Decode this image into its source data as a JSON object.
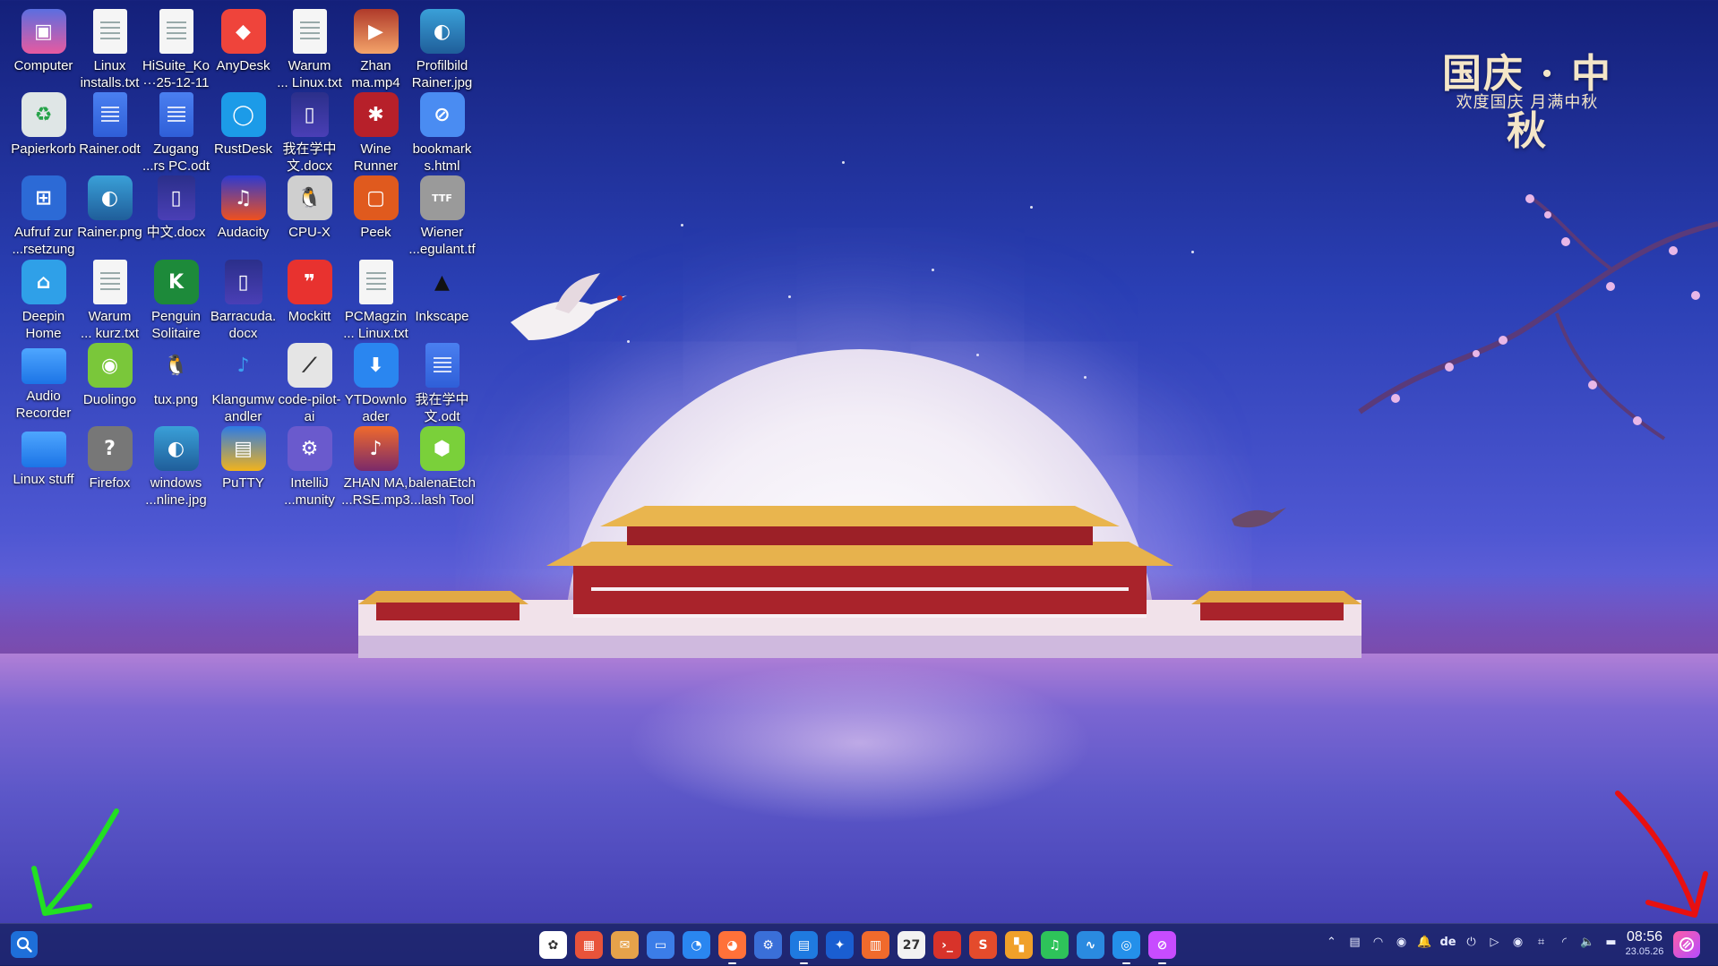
{
  "wallpaper": {
    "title": "国庆 · 中秋",
    "subtitle": "欢度国庆 月满中秋"
  },
  "desktop_icons": [
    {
      "label": "Computer",
      "icon": "computer-icon"
    },
    {
      "label": "Linux\ninstalls.txt",
      "icon": "text-file-icon"
    },
    {
      "label": "HiSuite_Ko\n···25-12-11",
      "icon": "text-file-icon"
    },
    {
      "label": "AnyDesk",
      "icon": "anydesk-icon"
    },
    {
      "label": "Warum\n... Linux.txt",
      "icon": "text-file-icon"
    },
    {
      "label": "Zhan\nma.mp4",
      "icon": "video-file-icon"
    },
    {
      "label": "Profilbild\nRainer.jpg",
      "icon": "image-file-icon"
    },
    {
      "label": "Papierkorb",
      "icon": "trash-icon"
    },
    {
      "label": "Rainer.odt",
      "icon": "odt-file-icon"
    },
    {
      "label": "Zugang\n...rs PC.odt",
      "icon": "odt-file-icon"
    },
    {
      "label": "RustDesk",
      "icon": "rustdesk-icon"
    },
    {
      "label": "我在学中\n文.docx",
      "icon": "docx-file-icon"
    },
    {
      "label": "Wine\nRunner",
      "icon": "wine-runner-icon"
    },
    {
      "label": "bookmark\ns.html",
      "icon": "html-file-icon"
    },
    {
      "label": "Aufruf zur\n...rsetzung",
      "icon": "app-grid-icon"
    },
    {
      "label": "Rainer.png",
      "icon": "image-file-icon"
    },
    {
      "label": "中文.docx",
      "icon": "docx-file-icon"
    },
    {
      "label": "Audacity",
      "icon": "audacity-icon"
    },
    {
      "label": "CPU-X",
      "icon": "cpu-x-icon"
    },
    {
      "label": "Peek",
      "icon": "peek-icon"
    },
    {
      "label": "Wiener\n...egulant.tf",
      "icon": "font-file-icon"
    },
    {
      "label": "Deepin\nHome",
      "icon": "deepin-home-icon"
    },
    {
      "label": "Warum\n... kurz.txt",
      "icon": "text-file-icon"
    },
    {
      "label": "Penguin\nSolitaire",
      "icon": "solitaire-icon"
    },
    {
      "label": "Barracuda.\ndocx",
      "icon": "docx-file-icon"
    },
    {
      "label": "Mockitt",
      "icon": "mockitt-icon"
    },
    {
      "label": "PCMagzin\n... Linux.txt",
      "icon": "text-file-icon"
    },
    {
      "label": "Inkscape",
      "icon": "inkscape-icon"
    },
    {
      "label": "Audio\nRecorder",
      "icon": "folder-icon"
    },
    {
      "label": "Duolingo",
      "icon": "duolingo-icon"
    },
    {
      "label": "tux.png",
      "icon": "tux-icon"
    },
    {
      "label": "Klangumw\nandler",
      "icon": "music-converter-icon"
    },
    {
      "label": "code-pilot-\nai",
      "icon": "code-pilot-icon"
    },
    {
      "label": "YTDownlo\nader",
      "icon": "ytdownloader-icon"
    },
    {
      "label": "我在学中\n文.odt",
      "icon": "odt-file-icon"
    },
    {
      "label": "Linux stuff",
      "icon": "folder-icon"
    },
    {
      "label": "Firefox",
      "icon": "firefox-icon"
    },
    {
      "label": "windows\n...nline.jpg",
      "icon": "image-file-icon"
    },
    {
      "label": "PuTTY",
      "icon": "putty-icon"
    },
    {
      "label": "IntelliJ\n...munity",
      "icon": "intellij-icon"
    },
    {
      "label": "ZHAN MA,\n...RSE.mp3",
      "icon": "audio-file-icon"
    },
    {
      "label": "balenaEtch\n...lash Tool",
      "icon": "balena-etcher-icon"
    }
  ],
  "taskbar": {
    "launcher_icon": "search-icon",
    "dock_apps": [
      {
        "name": "launcher-grid-icon",
        "color": "#ffffff",
        "active": false
      },
      {
        "name": "multitask-view-icon",
        "color": "#e8533a",
        "active": false
      },
      {
        "name": "mail-icon",
        "color": "#e6a24a",
        "active": false
      },
      {
        "name": "file-manager-icon",
        "color": "#3b7de8",
        "active": false
      },
      {
        "name": "browser-icon",
        "color": "#2a86f0",
        "active": false
      },
      {
        "name": "firefox-icon",
        "color": "#ff7139",
        "active": true
      },
      {
        "name": "settings-icon",
        "color": "#3a6fd8",
        "active": false
      },
      {
        "name": "app-store-icon",
        "color": "#1f7ae0",
        "active": true
      },
      {
        "name": "thunderbird-icon",
        "color": "#1a5ed1",
        "active": false
      },
      {
        "name": "archive-manager-icon",
        "color": "#f06a2c",
        "active": false
      },
      {
        "name": "calendar-icon",
        "color": "#f2f2f2",
        "active": false
      },
      {
        "name": "terminal-icon",
        "color": "#d8332a",
        "active": false
      },
      {
        "name": "scrobbler-icon",
        "color": "#e44b2c",
        "active": false
      },
      {
        "name": "windows-app-icon",
        "color": "#f0a02a",
        "active": false
      },
      {
        "name": "music-icon",
        "color": "#2ec35a",
        "active": false
      },
      {
        "name": "system-monitor-icon",
        "color": "#2a8ae0",
        "active": false
      },
      {
        "name": "screen-capture-icon",
        "color": "#2490ea",
        "active": true
      },
      {
        "name": "notification-center-icon",
        "color": "#c74cff",
        "active": true
      }
    ],
    "tray": {
      "keyboard_layout": "de",
      "icons": [
        "chevron-up-icon",
        "clipboard-icon",
        "mouse-icon",
        "eye-icon",
        "bell-icon",
        "keyboard-layout-icon",
        "power-icon",
        "media-icon",
        "record-icon",
        "screenshot-icon",
        "wifi-icon",
        "volume-icon",
        "storage-icon"
      ]
    },
    "clock": {
      "time": "08:56",
      "date": "23.05.26"
    }
  },
  "colors": {
    "taskbar": "#141e5a",
    "annotation_green": "#22e022",
    "annotation_red": "#e81010",
    "accent": "#1e6fd9"
  }
}
